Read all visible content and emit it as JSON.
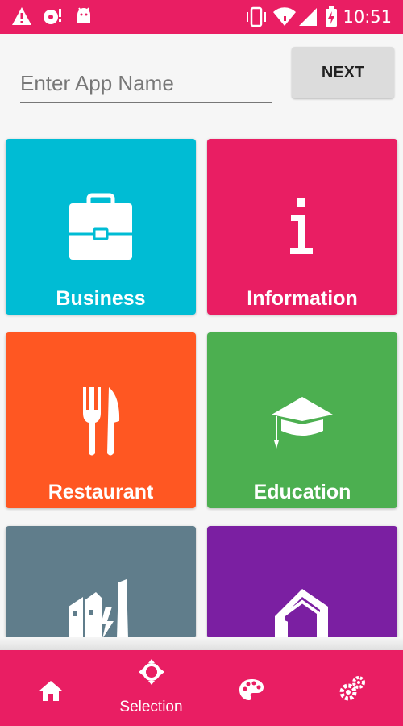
{
  "status_bar": {
    "time": "10:51"
  },
  "search": {
    "placeholder": "Enter App Name",
    "value": ""
  },
  "next_button": {
    "label": "NEXT"
  },
  "categories": [
    {
      "label": "Business",
      "color": "#00bcd4",
      "icon": "briefcase-icon"
    },
    {
      "label": "Information",
      "color": "#e91e63",
      "icon": "info-icon"
    },
    {
      "label": "Restaurant",
      "color": "#ff5722",
      "icon": "fork-knife-icon"
    },
    {
      "label": "Education",
      "color": "#4caf50",
      "icon": "graduation-cap-icon"
    },
    {
      "label": "",
      "color": "#607d8b",
      "icon": "factory-icon"
    },
    {
      "label": "",
      "color": "#7b1fa2",
      "icon": "house-icon"
    }
  ],
  "bottom_nav": {
    "items": [
      {
        "label": "",
        "icon": "home-icon"
      },
      {
        "label": "Selection",
        "icon": "selection-icon",
        "active": true
      },
      {
        "label": "",
        "icon": "palette-icon"
      },
      {
        "label": "",
        "icon": "settings-gears-icon"
      }
    ]
  },
  "colors": {
    "accent": "#e91e63"
  }
}
